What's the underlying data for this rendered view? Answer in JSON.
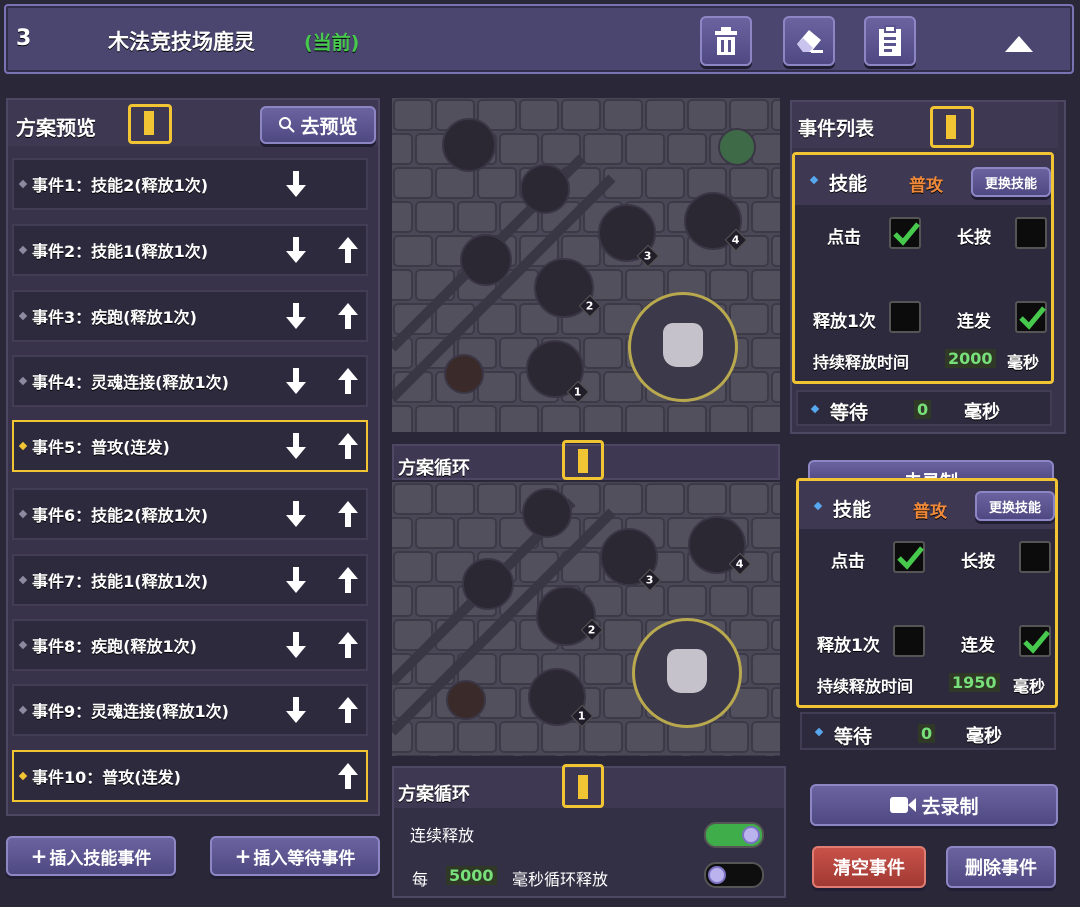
{
  "title_bar": {
    "number": "3",
    "name": "木法竞技场鹿灵",
    "status": "(当前)",
    "icons": [
      "trash-icon",
      "eraser-icon",
      "clipboard-icon",
      "collapse-triangle-icon"
    ]
  },
  "preview": {
    "title": "方案预览",
    "go_preview": "去预览",
    "events": [
      {
        "label": "事件1：技能2(释放1次)",
        "down": true,
        "up": false,
        "selected": false
      },
      {
        "label": "事件2：技能1(释放1次)",
        "down": true,
        "up": true,
        "selected": false
      },
      {
        "label": "事件3：疾跑(释放1次)",
        "down": true,
        "up": true,
        "selected": false
      },
      {
        "label": "事件4：灵魂连接(释放1次)",
        "down": true,
        "up": true,
        "selected": false
      },
      {
        "label": "事件5：普攻(连发)",
        "down": true,
        "up": true,
        "selected": true
      },
      {
        "label": "事件6：技能2(释放1次)",
        "down": true,
        "up": true,
        "selected": false
      },
      {
        "label": "事件7：技能1(释放1次)",
        "down": true,
        "up": true,
        "selected": false
      },
      {
        "label": "事件8：疾跑(释放1次)",
        "down": true,
        "up": true,
        "selected": false
      },
      {
        "label": "事件9：灵魂连接(释放1次)",
        "down": true,
        "up": true,
        "selected": false
      },
      {
        "label": "事件10：普攻(连发)",
        "down": false,
        "up": true,
        "selected": true
      }
    ],
    "insert_skill": "插入技能事件",
    "insert_wait": "插入等待事件"
  },
  "event_list": {
    "title": "事件列表",
    "skill_card_1": {
      "skill_label": "技能",
      "skill_value": "普攻",
      "change_btn": "更换技能",
      "click": "点击",
      "click_checked": true,
      "long_press": "长按",
      "long_press_checked": false,
      "release_once": "释放1次",
      "release_once_checked": false,
      "burst": "连发",
      "burst_checked": true,
      "duration_label": "持续释放时间",
      "duration_value": "2000",
      "duration_unit": "毫秒"
    },
    "wait_1": {
      "label": "等待",
      "value": "0",
      "unit": "毫秒"
    },
    "skill_card_2": {
      "skill_label": "技能",
      "skill_value": "普攻",
      "change_btn": "更换技能",
      "click": "点击",
      "click_checked": true,
      "long_press": "长按",
      "long_press_checked": false,
      "release_once": "释放1次",
      "release_once_checked": false,
      "burst": "连发",
      "burst_checked": true,
      "duration_label": "持续释放时间",
      "duration_value": "1950",
      "duration_unit": "毫秒"
    },
    "wait_2": {
      "label": "等待",
      "value": "0",
      "unit": "毫秒"
    },
    "record_partial": "去录制"
  },
  "loop_mid": {
    "title": "方案循环"
  },
  "loop_bottom": {
    "title": "方案循环",
    "continuous": "连续释放",
    "continuous_on": true,
    "every": "每",
    "every_value": "5000",
    "every_suffix": "毫秒循环释放",
    "loop_on": false
  },
  "actions": {
    "record": "去录制",
    "clear": "清空事件",
    "delete": "删除事件"
  },
  "map_markers": [
    "1",
    "2",
    "3",
    "4"
  ],
  "colors": {
    "accent_yellow": "#f0c432",
    "value_green": "#77e07a",
    "clear_red": "#b8443c",
    "status_green": "#46c94c"
  }
}
